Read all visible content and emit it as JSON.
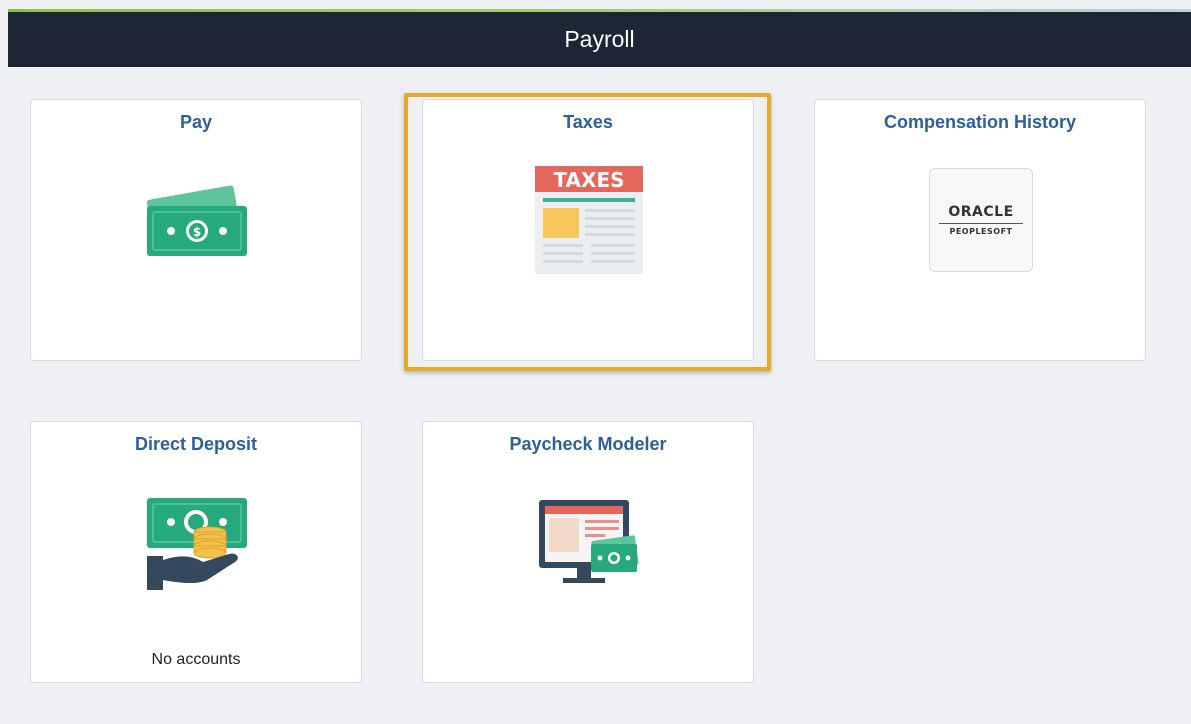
{
  "header": {
    "title": "Payroll"
  },
  "tiles": [
    {
      "title": "Pay",
      "icon": "money-icon",
      "footer": ""
    },
    {
      "title": "Taxes",
      "icon": "taxes-document-icon",
      "footer": "",
      "icon_text": "TAXES",
      "focused": true
    },
    {
      "title": "Compensation History",
      "icon": "oracle-peoplesoft-logo",
      "footer": "",
      "logo_line1": "ORACLE",
      "logo_line2": "PEOPLESOFT"
    },
    {
      "title": "Direct Deposit",
      "icon": "hand-money-icon",
      "footer": "No accounts"
    },
    {
      "title": "Paycheck Modeler",
      "icon": "monitor-money-icon",
      "footer": ""
    }
  ],
  "colors": {
    "header_bg": "#1c2634",
    "tile_title": "#2d5f99",
    "focus": "#e8a928",
    "money_green": "#26a97c"
  }
}
